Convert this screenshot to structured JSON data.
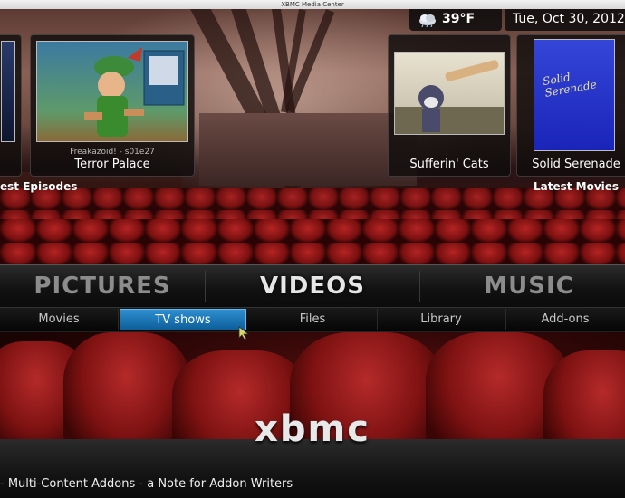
{
  "window": {
    "title": "XBMC Media Center"
  },
  "weather": {
    "temperature": "39°F",
    "icon": "cloud-icon"
  },
  "clock": {
    "date": "Tue, Oct 30, 2012"
  },
  "shelves": {
    "left_label": "est Episodes",
    "right_label": "Latest Movies",
    "episodes": [
      {
        "show": "Freakazoid! - s01e27",
        "title": "Terror Palace"
      }
    ],
    "movies": [
      {
        "title": "Sufferin' Cats"
      },
      {
        "title": "Solid Serenade"
      }
    ],
    "poster_caption": "Solid\nSerenade"
  },
  "main_menu": {
    "items": [
      {
        "label": "PICTURES",
        "color": "#8c8c8c"
      },
      {
        "label": "VIDEOS",
        "color": "#e6e6e6"
      },
      {
        "label": "MUSIC",
        "color": "#8c8c8c"
      }
    ],
    "selected": "VIDEOS"
  },
  "sub_menu": {
    "items": [
      {
        "label": "Movies"
      },
      {
        "label": "TV shows"
      },
      {
        "label": "Files"
      },
      {
        "label": "Library"
      },
      {
        "label": "Add-ons"
      }
    ],
    "selected": "TV shows"
  },
  "logo_text": "xbmc",
  "ticker": {
    "text": "- Multi-Content Addons - a Note for Addon Writers"
  },
  "colors": {
    "accent": "#1f78b8",
    "seat_red": "#9e1b1b"
  }
}
